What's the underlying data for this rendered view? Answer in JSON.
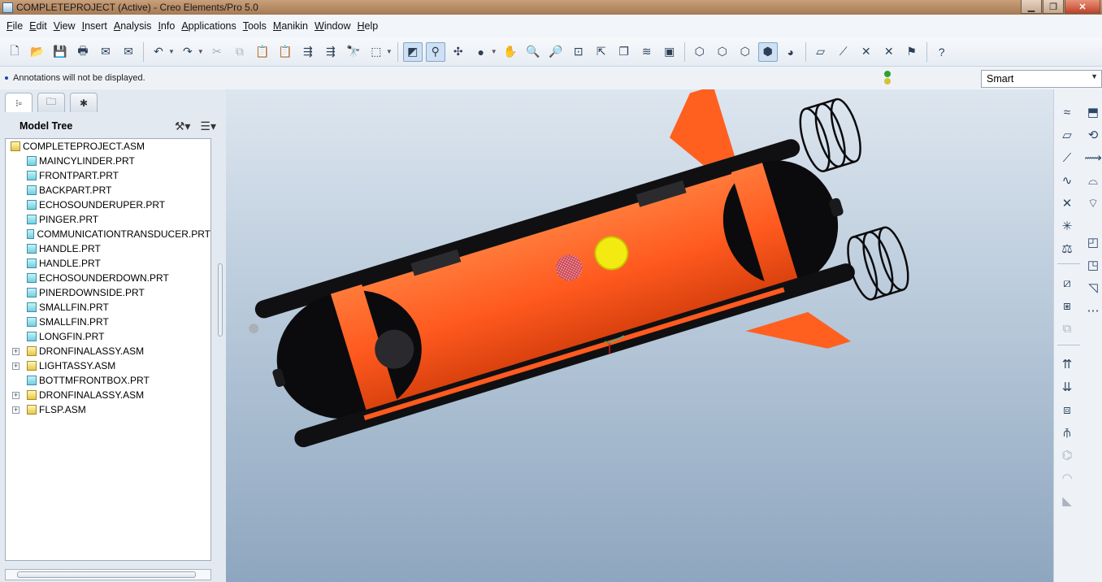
{
  "window": {
    "title": "COMPLETEPROJECT (Active) - Creo Elements/Pro 5.0",
    "minimize": "▁",
    "maximize": "❐",
    "close": "✕"
  },
  "menu": [
    "File",
    "Edit",
    "View",
    "Insert",
    "Analysis",
    "Info",
    "Applications",
    "Tools",
    "Manikin",
    "Window",
    "Help"
  ],
  "toolbar": {
    "icons": [
      "new-icon",
      "open-icon",
      "save-icon",
      "print-icon",
      "email-icon",
      "email-link-icon",
      "undo-icon",
      "redo-icon",
      "cut-icon",
      "copy-icon",
      "paste-icon",
      "paste-special-icon",
      "regenerate-icon",
      "regen-manager-icon",
      "find-icon",
      "select-box-icon",
      "refit-icon",
      "repaint-icon",
      "spin-center-icon",
      "display-style-icon",
      "orient-mode-icon",
      "zoom-in-icon",
      "zoom-out-icon",
      "zoom-refit-icon",
      "reorient-icon",
      "saved-views-icon",
      "layers-icon",
      "view-manager-icon",
      "wireframe-icon",
      "hidden-line-icon",
      "no-hidden-icon",
      "shading-icon",
      "enhanced-realism-icon",
      "datum-planes-icon",
      "datum-axes-icon",
      "datum-points-icon",
      "csys-icon",
      "annotations-icon",
      "context-help-icon"
    ]
  },
  "message": {
    "text": "Annotations will not be displayed."
  },
  "filter": {
    "value": "Smart"
  },
  "model_tree": {
    "header": "Model Tree",
    "items": [
      {
        "label": "COMPLETEPROJECT.ASM",
        "type": "root"
      },
      {
        "label": "MAINCYLINDER.PRT",
        "type": "part"
      },
      {
        "label": "FRONTPART.PRT",
        "type": "part"
      },
      {
        "label": "BACKPART.PRT",
        "type": "part"
      },
      {
        "label": "ECHOSOUNDERUPER.PRT",
        "type": "part"
      },
      {
        "label": "PINGER.PRT",
        "type": "part"
      },
      {
        "label": "COMMUNICATIONTRANSDUCER.PRT",
        "type": "part"
      },
      {
        "label": "HANDLE.PRT",
        "type": "part"
      },
      {
        "label": "HANDLE.PRT",
        "type": "part"
      },
      {
        "label": "ECHOSOUNDERDOWN.PRT",
        "type": "part"
      },
      {
        "label": "PINERDOWNSIDE.PRT",
        "type": "part"
      },
      {
        "label": "SMALLFIN.PRT",
        "type": "part"
      },
      {
        "label": "SMALLFIN.PRT",
        "type": "part"
      },
      {
        "label": "LONGFIN.PRT",
        "type": "part"
      },
      {
        "label": "DRONFINALASSY.ASM",
        "type": "asm"
      },
      {
        "label": "LIGHTASSY.ASM",
        "type": "asm"
      },
      {
        "label": "BOTTMFRONTBOX.PRT",
        "type": "part"
      },
      {
        "label": "DRONFINALASSY.ASM",
        "type": "asm"
      },
      {
        "label": "FLSP.ASM",
        "type": "asm"
      }
    ]
  },
  "colors": {
    "hull": "#ff5a1f",
    "hull_dark": "#e0440f",
    "black_parts": "#0b0b0d",
    "pinger_yellow": "#f2ea11",
    "background_top": "#dde6ef",
    "background_bottom": "#8ea6bf"
  }
}
